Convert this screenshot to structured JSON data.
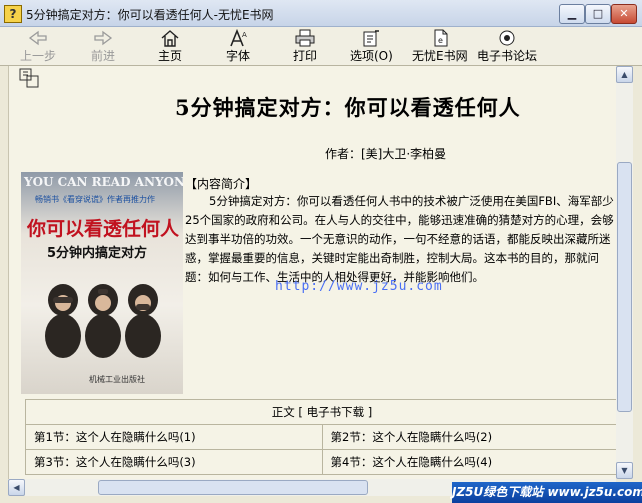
{
  "window": {
    "title": "5分钟搞定对方：你可以看透任何人-无忧E书网"
  },
  "toolbar": {
    "back": "上一步",
    "forward": "前进",
    "home": "主页",
    "font": "字体",
    "print": "打印",
    "options": "选项(O)",
    "wuyou": "无忧E书网",
    "forum": "电子书论坛"
  },
  "book": {
    "title": "5分钟搞定对方：你可以看透任何人",
    "author": "作者：[美]大卫·李柏曼",
    "cover": {
      "english": "YOU CAN READ ANYONE",
      "tagline": "畅销书《看穿说谎》作者再推力作",
      "title_zh": "你可以看透任何人",
      "subtitle": "5分钟内搞定对方",
      "publisher": "机械工业出版社"
    },
    "intro_heading": "【内容简介】",
    "intro": "5分钟搞定对方：你可以看透任何人书中的技术被广泛使用在美国FBI、海军部少25个国家的政府和公司。在人与人的交往中，能够迅速准确的猜楚对方的心理，会够达到事半功倍的功效。一个无意识的动作，一句不经意的话语，都能反映出深藏所迷惑，掌握最重要的信息，关键时定能出奇制胜，控制大局。这本书的目的，那就问题：如何与工作、生活中的人相处得更好，并能影响他们。",
    "url": "http://www.jz5u.com"
  },
  "toc": {
    "header": "正文 [ 电子书下载 ]",
    "rows": [
      [
        "第1节：这个人在隐瞒什么吗(1)",
        "第2节：这个人在隐瞒什么吗(2)"
      ],
      [
        "第3节：这个人在隐瞒什么吗(3)",
        "第4节：这个人在隐瞒什么吗(4)"
      ]
    ]
  },
  "watermark": "JZ5U绿色下载站 www.jz5u.com"
}
